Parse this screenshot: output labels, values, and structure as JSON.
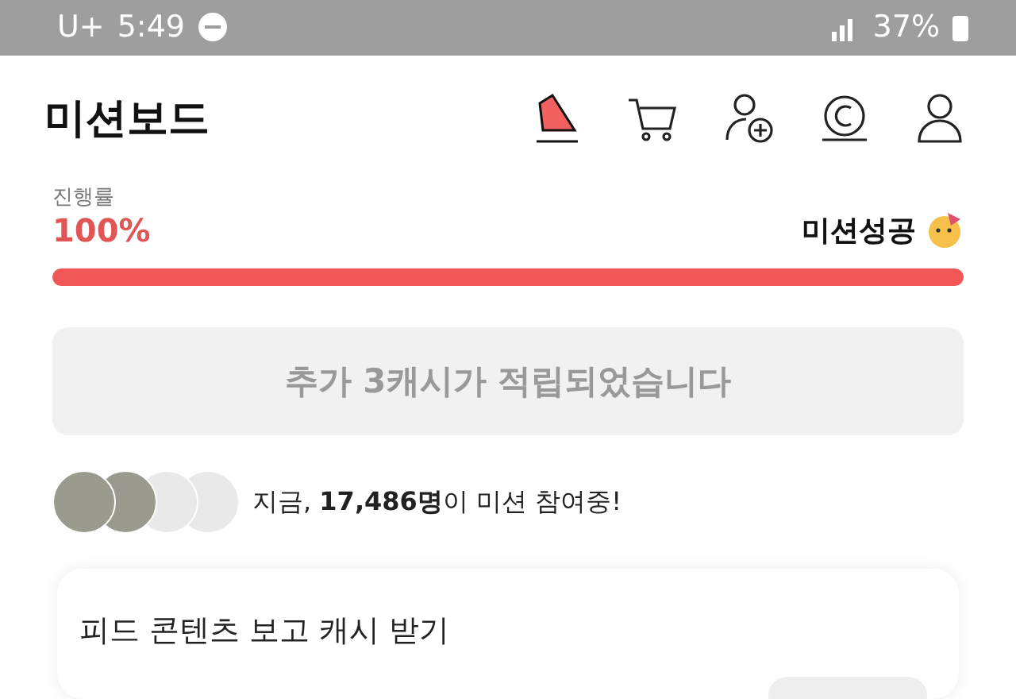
{
  "status_bar": {
    "carrier": "U+",
    "time": "5:49",
    "battery": "37%"
  },
  "header": {
    "title": "미션보드"
  },
  "progress": {
    "label": "진행률",
    "value": "100%",
    "status": "미션성공",
    "level": 1
  },
  "reward_notice": "추가 3캐시가 적립되었습니다",
  "participants": {
    "text": "지금, **17,486명**이 미션 참여중!",
    "avatars": [
      {
        "kind": "photo"
      },
      {
        "kind": "photo"
      },
      {
        "kind": "blank"
      },
      {
        "kind": "blank"
      }
    ]
  },
  "card": {
    "title": "피드 콘텐츠 보고 캐시 받기"
  }
}
